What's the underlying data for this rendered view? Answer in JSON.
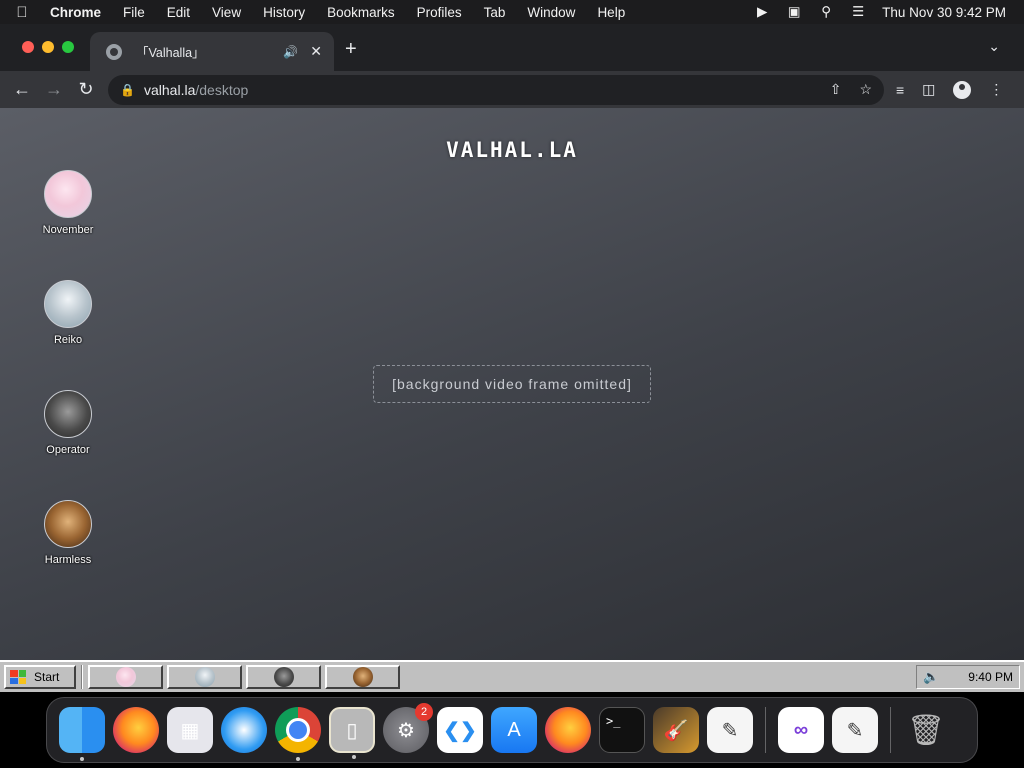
{
  "menubar": {
    "app_name": "Chrome",
    "items": [
      "File",
      "Edit",
      "View",
      "History",
      "Bookmarks",
      "Profiles",
      "Tab",
      "Window",
      "Help"
    ],
    "clock": "Thu Nov 30  9:42 PM"
  },
  "browser": {
    "tab_title": "「Valhalla」",
    "url_host": "valhal.la",
    "url_path": "/desktop"
  },
  "page": {
    "logo": "VALHAL.LA",
    "background_note": "[background video frame omitted]",
    "desktop_icons": [
      {
        "label": "November",
        "icon": "november-avatar"
      },
      {
        "label": "Reiko",
        "icon": "reiko-avatar"
      },
      {
        "label": "Operator",
        "icon": "operator-avatar"
      },
      {
        "label": "Harmless",
        "icon": "harmless-avatar"
      }
    ],
    "taskbar": {
      "start_label": "Start",
      "clock": "9:40 PM"
    }
  },
  "dock": {
    "apps": [
      {
        "name": "Finder",
        "icon": "finder-icon",
        "running": true
      },
      {
        "name": "Firefox",
        "icon": "firefox-icon",
        "running": false
      },
      {
        "name": "Launchpad",
        "icon": "launchpad-icon",
        "running": false
      },
      {
        "name": "Safari",
        "icon": "safari-icon",
        "running": false
      },
      {
        "name": "Chrome",
        "icon": "chrome-icon",
        "running": true
      },
      {
        "name": "Simulator",
        "icon": "simulator-icon",
        "running": true
      },
      {
        "name": "System Settings",
        "icon": "settings-icon",
        "running": false,
        "badge": "2"
      },
      {
        "name": "VS Code",
        "icon": "vscode-icon",
        "running": false
      },
      {
        "name": "App Store",
        "icon": "appstore-icon",
        "running": false
      },
      {
        "name": "Firefox Developer",
        "icon": "firefox-icon",
        "running": false
      },
      {
        "name": "Terminal",
        "icon": "terminal-icon",
        "running": false
      },
      {
        "name": "GarageBand",
        "icon": "garageband-icon",
        "running": false
      },
      {
        "name": "TextEdit",
        "icon": "textedit-icon",
        "running": false
      }
    ],
    "recent": [
      {
        "name": "Visual Studio",
        "icon": "vstudio-icon"
      },
      {
        "name": "TextEdit",
        "icon": "textedit-icon"
      }
    ],
    "trash": {
      "name": "Trash",
      "icon": "trash-icon"
    }
  }
}
